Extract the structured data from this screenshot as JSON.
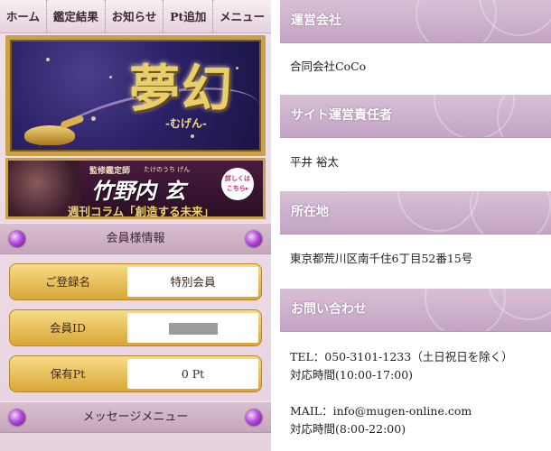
{
  "nav": {
    "items": [
      "ホーム",
      "鑑定結果",
      "お知らせ",
      "Pt追加",
      "メニュー"
    ]
  },
  "hero": {
    "title": "夢幻",
    "subtitle": "-むげん-"
  },
  "master": {
    "role": "監修鑑定師",
    "ruby": "たけのうち げん",
    "name": "竹野内 玄",
    "column": "週刊コラム「創造する未来」",
    "cta_line1": "詳しくは",
    "cta_line2": "こちら▸"
  },
  "member": {
    "header": "会員様情報",
    "rows": [
      {
        "label": "ご登録名",
        "value": "特別会員"
      },
      {
        "label": "会員ID",
        "value": ""
      },
      {
        "label": "保有Pt",
        "value": "0 Pt"
      }
    ]
  },
  "message_menu": {
    "header": "メッセージメニュー"
  },
  "company": {
    "sections": [
      {
        "heading": "運営会社",
        "lines": [
          "合同会社CoCo"
        ]
      },
      {
        "heading": "サイト運営責任者",
        "lines": [
          "平井 裕太"
        ]
      },
      {
        "heading": "所在地",
        "lines": [
          "東京都荒川区南千住6丁目52番15号"
        ]
      },
      {
        "heading": "お問い合わせ",
        "lines": [
          "TEL：050-3101-1233（土日祝日を除く）",
          "対応時間(10:00-17:00)",
          "",
          "MAIL：info@mugen-online.com",
          "対応時間(8:00-22:00)"
        ]
      }
    ]
  },
  "colors": {
    "gold": "#c8a24a",
    "lavender": "#d9bfd0",
    "accent": "#b54be0"
  }
}
